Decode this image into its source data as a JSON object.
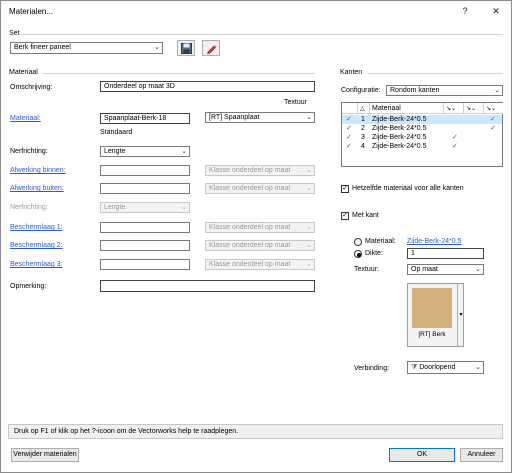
{
  "window": {
    "title": "Materialen...",
    "help_btn": "?",
    "close_btn": "✕"
  },
  "set": {
    "group_label": "Set",
    "selected": "Berk fineer paneel"
  },
  "materiaal": {
    "group_label": "Materiaal",
    "omschrijving_label": "Omschrijving:",
    "omschrijving_value": "Onderdeel op maat 3D",
    "textuur_header": "Textuur",
    "materiaal_label": "Materiaal:",
    "materiaal_value": "Spaanplaat-Berk-18",
    "textuur_value": "[RT] Spaanplaat",
    "standaard_label": "Standaard",
    "nerfrichting_label": "Nerfrichting:",
    "nerfrichting_value": "Lengte",
    "afwerking_binnen_label": "Afwerking binnen:",
    "afwerking_binnen_select": "Klasse onderdeel op maat",
    "afwerking_buiten_label": "Afwerking buiten:",
    "afwerking_buiten_select": "Klasse onderdeel op maat",
    "nerfrichting2_label": "Nerfrichting:",
    "nerfrichting2_value": "Lengte",
    "beschermlaag1_label": "Beschermlaag 1:",
    "beschermlaag1_select": "Klasse onderdeel op maat",
    "beschermlaag2_label": "Beschermlaag 2:",
    "beschermlaag2_select": "Klasse onderdeel op maat",
    "beschermlaag3_label": "Beschermlaag 3:",
    "beschermlaag3_select": "Klasse onderdeel op maat",
    "opmerking_label": "Opmerking:"
  },
  "kanten": {
    "group_label": "Kanten",
    "configuratie_label": "Configuratie:",
    "configuratie_value": "Rondom kanten",
    "table_header_materiaal": "Materiaal",
    "rows": [
      {
        "num": "1",
        "name": "Zijde-Berk-24*0.5"
      },
      {
        "num": "2",
        "name": "Zijde-Berk-24*0.5"
      },
      {
        "num": "3",
        "name": "Zijde-Berk-24*0.5"
      },
      {
        "num": "4",
        "name": "Zijde-Berk-24*0.5"
      }
    ],
    "hetzelfde_label": "Hetzelfde materiaal voor alle kanten",
    "met_kant_label": "Met kant",
    "materiaal_radio_label": "Materiaal:",
    "materiaal_link": "Zijde-Berk-24*0.5",
    "dikte_radio_label": "Dikte:",
    "dikte_value": "1",
    "textuur_label": "Textuur:",
    "textuur_value": "Op maat",
    "swatch_label": "[RT] Berk",
    "swatch_color": "#d2b07c",
    "verbinding_label": "Verbinding:",
    "verbinding_value": "Doorlopend"
  },
  "status_text": "Druk op F1 of klik op het ?-icoon om de Vectorworks help te raadplegen.",
  "footer": {
    "verwijder": "Verwijder materialen",
    "ok": "OK",
    "annuleer": "Annuleer"
  }
}
